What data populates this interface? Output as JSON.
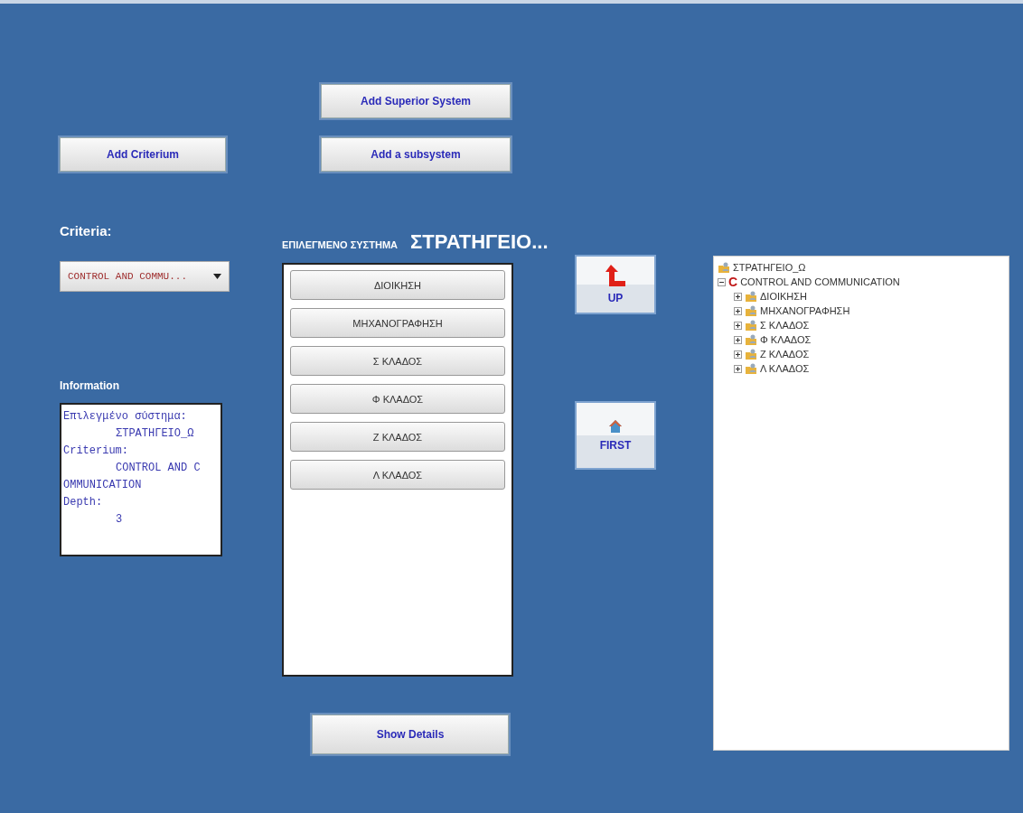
{
  "buttons": {
    "add_superior": "Add Superior System",
    "add_subsystem": "Add a subsystem",
    "add_criterium": "Add Criterium",
    "show_details": "Show Details",
    "up": "UP",
    "first": "FIRST"
  },
  "criteria": {
    "label": "Criteria:",
    "value": "CONTROL AND COMMU..."
  },
  "information": {
    "label": "Information",
    "lines": [
      {
        "kind": "label",
        "text": "Επιλεγμένο σύστημα:"
      },
      {
        "kind": "value",
        "text": "ΣΤΡΑΤΗΓΕΙΟ_Ω"
      },
      {
        "kind": "label",
        "text": "Criterium:"
      },
      {
        "kind": "value",
        "text": "CONTROL AND C"
      },
      {
        "kind": "label",
        "text": "OMMUNICATION"
      },
      {
        "kind": "label",
        "text": "Depth:"
      },
      {
        "kind": "value",
        "text": "3"
      }
    ]
  },
  "selected_system": {
    "caption": "ΕΠΙΛΕΓΜΕΝΟ ΣΥΣΤΗΜΑ",
    "name": "ΣΤΡΑΤΗΓΕΙΟ..."
  },
  "subsystems": [
    "ΔΙΟΙΚΗΣΗ",
    "ΜΗΧΑΝΟΓΡΑΦΗΣΗ",
    "Σ ΚΛΑΔΟΣ",
    "Φ ΚΛΑΔΟΣ",
    "Ζ ΚΛΑΔΟΣ",
    "Λ ΚΛΑΔΟΣ"
  ],
  "tree": [
    {
      "label": "ΣΤΡΑΤΗΓΕΙΟ_Ω",
      "kind": "system",
      "children": [
        {
          "label": "CONTROL AND COMMUNICATION",
          "kind": "criterion",
          "icon_letter": "C",
          "expanded": true,
          "children": [
            {
              "label": "ΔΙΟΙΚΗΣΗ",
              "kind": "system",
              "expanded": false
            },
            {
              "label": "ΜΗΧΑΝΟΓΡΑΦΗΣΗ",
              "kind": "system",
              "expanded": false
            },
            {
              "label": "Σ ΚΛΑΔΟΣ",
              "kind": "system",
              "expanded": false
            },
            {
              "label": "Φ ΚΛΑΔΟΣ",
              "kind": "system",
              "expanded": false
            },
            {
              "label": "Ζ ΚΛΑΔΟΣ",
              "kind": "system",
              "expanded": false
            },
            {
              "label": "Λ ΚΛΑΔΟΣ",
              "kind": "system",
              "expanded": false
            }
          ]
        }
      ]
    }
  ]
}
